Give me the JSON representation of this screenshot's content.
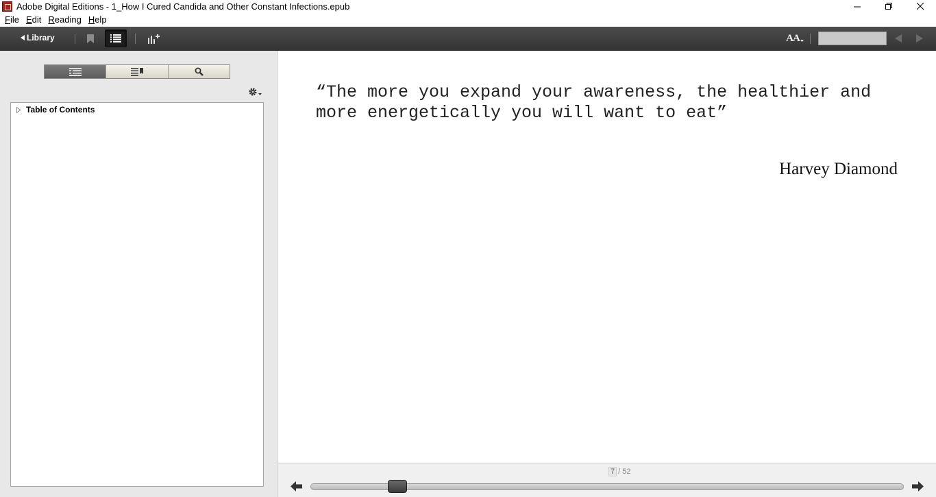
{
  "window": {
    "title": "Adobe Digital Editions - 1_How I Cured Candida and Other Constant Infections.epub"
  },
  "menu": {
    "items": [
      {
        "label": "File",
        "accel": "F",
        "rest": "ile"
      },
      {
        "label": "Edit",
        "accel": "E",
        "rest": "dit"
      },
      {
        "label": "Reading",
        "accel": "R",
        "rest": "eading"
      },
      {
        "label": "Help",
        "accel": "H",
        "rest": "elp"
      }
    ]
  },
  "toolbar": {
    "library_label": "Library",
    "font_size_label": "AA",
    "nav_search_value": ""
  },
  "sidebar": {
    "toc_label": "Table of Contents"
  },
  "content": {
    "quote": "“The more you expand your awareness, the healthier and more energetically you will want to eat”",
    "author": "Harvey Diamond"
  },
  "navigation": {
    "current_page": "7",
    "total_pages": "/ 52",
    "progress": 0.135
  }
}
